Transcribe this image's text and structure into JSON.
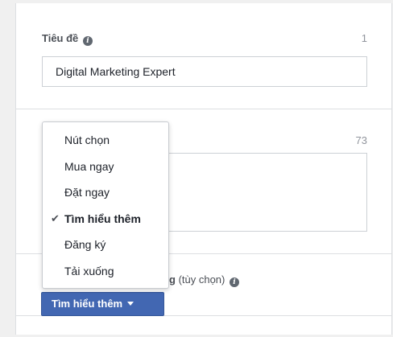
{
  "headline": {
    "label": "Tiêu đề",
    "info_icon": "info-icon",
    "counter": "1",
    "value": "Digital Marketing Expert"
  },
  "text": {
    "counter": "73"
  },
  "cta": {
    "label_partial": "g",
    "label_optional": " (tùy chọn)",
    "info_icon": "info-icon",
    "button_label": "Tìm hiểu thêm",
    "button_icon": "caret-down-icon",
    "button_color": "#4267b2"
  },
  "dropdown": {
    "items": [
      {
        "label": "Nút chọn",
        "selected": false
      },
      {
        "label": "Mua ngay",
        "selected": false
      },
      {
        "label": "Đặt ngay",
        "selected": false
      },
      {
        "label": "Tìm hiểu thêm",
        "selected": true
      },
      {
        "label": "Đăng ký",
        "selected": false
      },
      {
        "label": "Tải xuống",
        "selected": false
      }
    ],
    "check_icon": "✔"
  }
}
